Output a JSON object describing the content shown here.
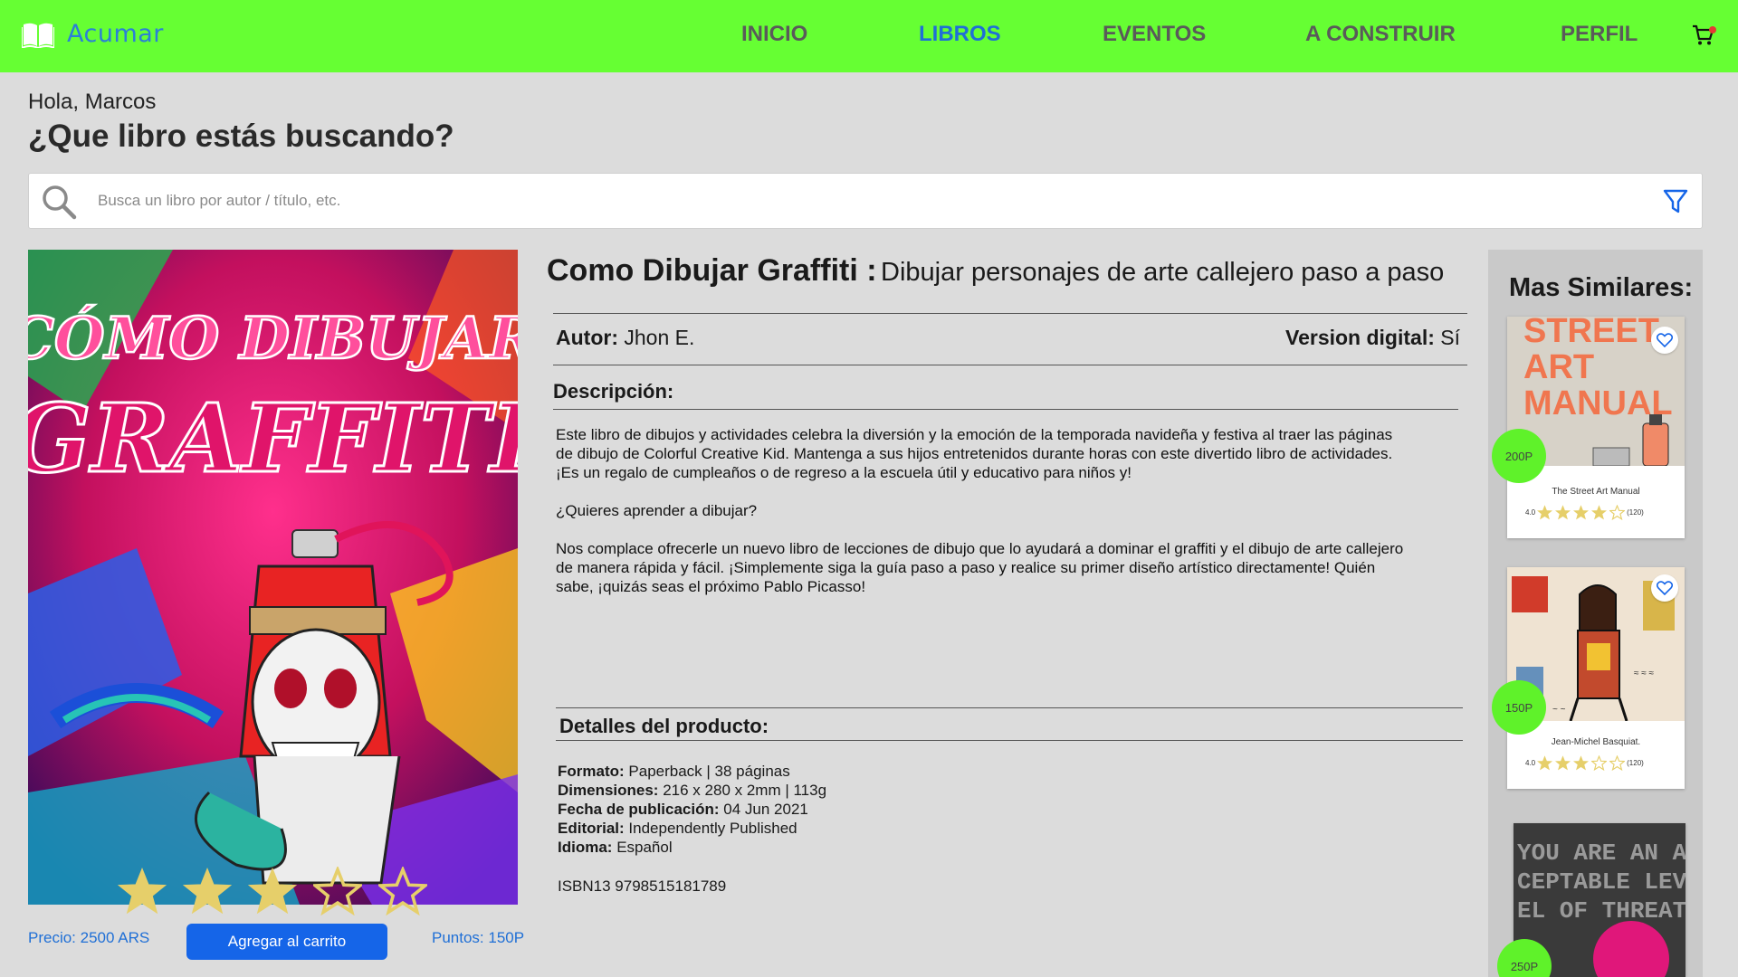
{
  "app": {
    "name": "Acumar"
  },
  "nav": {
    "items": [
      {
        "label": "INICIO",
        "active": false
      },
      {
        "label": "LIBROS",
        "active": true
      },
      {
        "label": "EVENTOS",
        "active": false
      },
      {
        "label": "A CONSTRUIR",
        "active": false
      },
      {
        "label": "PERFIL",
        "active": false
      }
    ]
  },
  "greeting": {
    "hello": "Hola, Marcos",
    "question": "¿Que libro estás buscando?"
  },
  "search": {
    "placeholder": "Busca un libro por autor / título, etc.",
    "value": ""
  },
  "book": {
    "title": "Como Dibujar Graffiti :",
    "subtitle": "Dibujar personajes de arte callejero paso a paso",
    "cover_text_1": "CÓMO DIBUJAR",
    "cover_text_2": "GRAFFITI",
    "rating": 3,
    "rating_max": 5,
    "author_label": "Autor:",
    "author": "Jhon E.",
    "digital_label": "Version digital:",
    "digital": "Sí",
    "description_heading": "Descripción:",
    "description": [
      "Este libro de dibujos y actividades celebra la diversión y la emoción de la temporada navideña y festiva al traer las páginas de dibujo de Colorful Creative Kid. Mantenga a sus hijos entretenidos durante horas con este divertido libro de actividades. ¡Es un regalo de cumpleaños o de regreso a la escuela útil y educativo para niños y!",
      "¿Quieres aprender a dibujar?",
      "Nos complace ofrecerle un nuevo libro de lecciones de dibujo que lo ayudará a dominar el graffiti y el dibujo de arte callejero de manera rápida y fácil. ¡Simplemente siga la guía paso a paso y realice su primer diseño artístico directamente! Quién sabe, ¡quizás seas el próximo Pablo Picasso!"
    ],
    "details_heading": "Detalles del producto:",
    "details": [
      {
        "label": "Formato:",
        "value": "Paperback | 38 páginas"
      },
      {
        "label": "Dimensiones:",
        "value": "216 x 280 x 2mm | 113g"
      },
      {
        "label": "Fecha de publicación:",
        "value": "04 Jun 2021"
      },
      {
        "label": "Editorial:",
        "value": "Independently Published"
      },
      {
        "label": "Idioma:",
        "value": "Español"
      }
    ],
    "isbn": "ISBN13 9798515181789",
    "price": "Precio: 2500 ARS",
    "add_to_cart": "Agregar al carrito",
    "points": "Puntos: 150P"
  },
  "similar": {
    "heading": "Mas Similares:",
    "items": [
      {
        "title": "The Street Art Manual",
        "cover_text": "STREET ART MANUAL",
        "rating_text": "4.0",
        "stars": 4,
        "reviews": "(120)",
        "points": "200P"
      },
      {
        "title": "Jean-Michel Basquiat.",
        "rating_text": "4.0",
        "stars": 3,
        "reviews": "(120)",
        "points": "150P"
      },
      {
        "title": "",
        "cover_text": "YOU ARE AN ACCEPTABLE LEVEL OF THREAT",
        "points": "250P"
      }
    ]
  },
  "colors": {
    "nav_bg": "#66ff33",
    "brand_blue": "#2b7fd8",
    "active": "#1f6fd6",
    "button": "#1565e8",
    "points_badge": "#5ff22a",
    "star": "#e6cf6a"
  },
  "icons": [
    "book-icon",
    "cart-icon",
    "search-icon",
    "filter-icon",
    "star-icon",
    "heart-icon"
  ]
}
